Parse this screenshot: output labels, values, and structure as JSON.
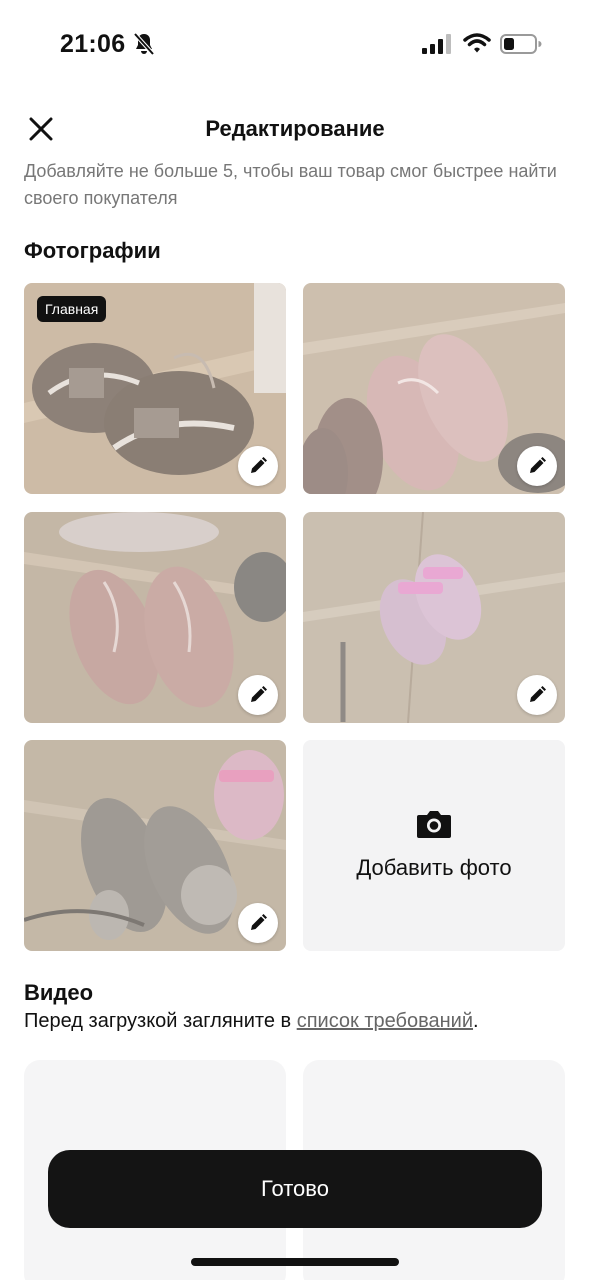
{
  "status": {
    "time": "21:06"
  },
  "nav": {
    "title": "Редактирование"
  },
  "hint": "Добавляйте не больше 5, чтобы ваш товар смог быстрее найти своего покупателя",
  "photos": {
    "title": "Фотографии",
    "main_badge": "Главная",
    "add_label": "Добавить фото"
  },
  "video": {
    "title": "Видео",
    "desc_prefix": "Перед загрузкой загляните в ",
    "desc_link": "список требований",
    "desc_suffix": "."
  },
  "done_label": "Готово"
}
